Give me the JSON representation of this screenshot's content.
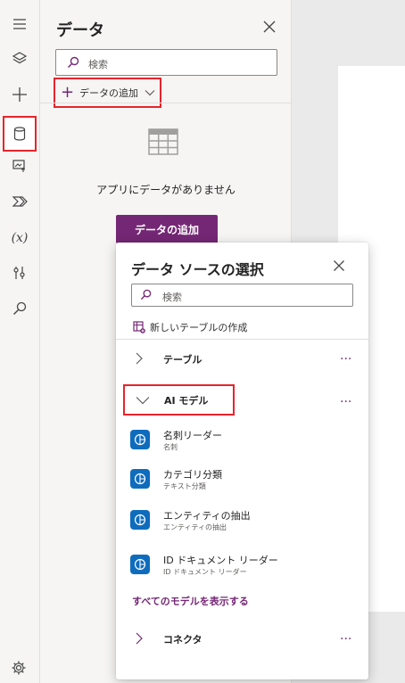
{
  "rail": {
    "items": [
      {
        "icon": "hamburger-menu-icon"
      },
      {
        "icon": "layers-icon"
      },
      {
        "icon": "plus-icon"
      },
      {
        "icon": "database-icon",
        "active": true
      },
      {
        "icon": "media-icon"
      },
      {
        "icon": "power-automate-icon"
      },
      {
        "icon": "variables-icon",
        "label": "(x)"
      },
      {
        "icon": "advanced-tools-icon"
      },
      {
        "icon": "search-icon"
      }
    ],
    "settings_icon": "settings-gear-icon"
  },
  "data_panel": {
    "title": "データ",
    "search_placeholder": "検索",
    "add_data_label": "データの追加",
    "empty_message": "アプリにデータがありません",
    "add_data_button": "データの追加"
  },
  "flyout": {
    "title": "データ ソースの選択",
    "search_placeholder": "検索",
    "new_table_label": "新しいテーブルの作成",
    "groups": [
      {
        "label": "テーブル",
        "expanded": false,
        "more": "..."
      },
      {
        "label": "AI モデル",
        "expanded": true,
        "more": "..."
      },
      {
        "label": "コネクタ",
        "expanded": false,
        "more": "..."
      }
    ],
    "ai_models": [
      {
        "name": "名刺リーダー",
        "sub": "名刺"
      },
      {
        "name": "カテゴリ分類",
        "sub": "テキスト分類"
      },
      {
        "name": "エンティティの抽出",
        "sub": "エンティティの抽出"
      },
      {
        "name": "ID ドキュメント リーダー",
        "sub": "ID ドキュメント リーダー"
      }
    ],
    "show_all_label": "すべてのモデルを表示する"
  },
  "colors": {
    "accent": "#742774",
    "highlight": "#e8242b",
    "ai_icon": "#0f6cbd"
  }
}
